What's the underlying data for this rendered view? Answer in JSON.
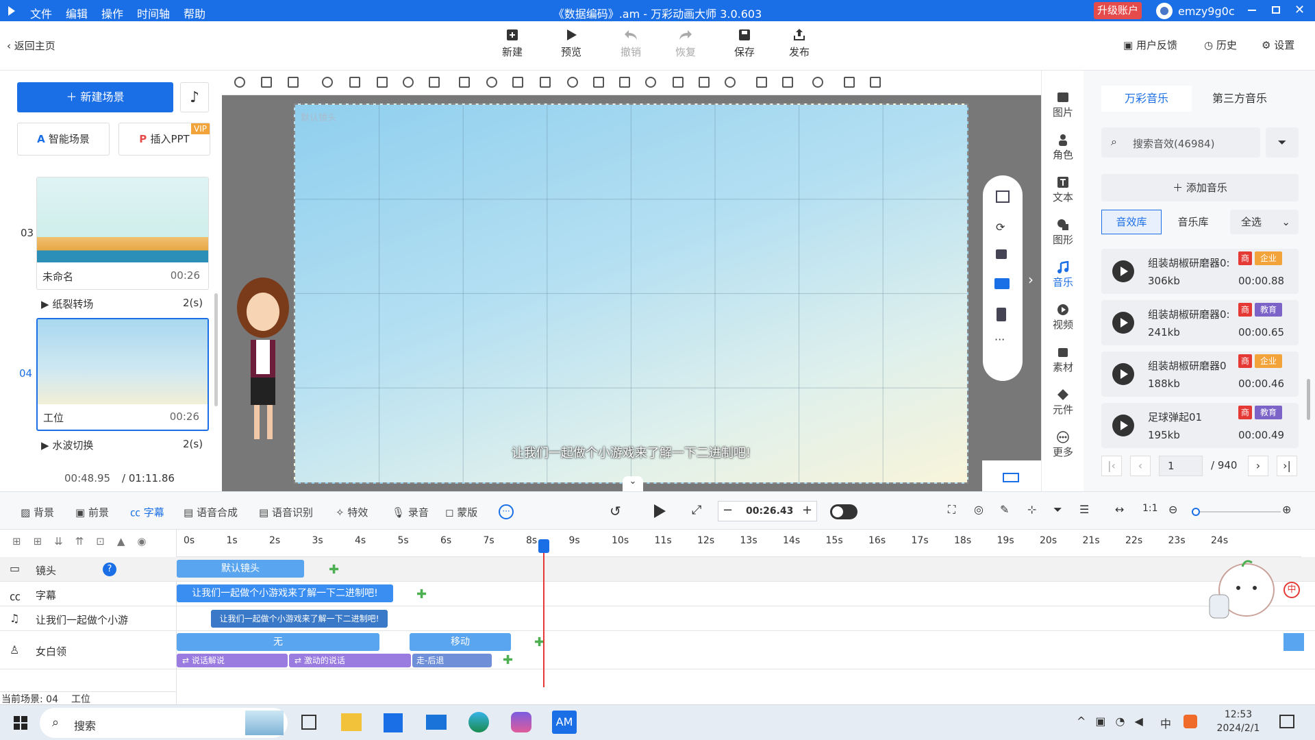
{
  "app": {
    "title": "《数据编码》.am - 万彩动画大师 3.0.603",
    "upgrade": "升级账户",
    "user": "emzy9g0c"
  },
  "menu": [
    "文件",
    "编辑",
    "操作",
    "时间轴",
    "帮助"
  ],
  "toolbar": {
    "back": "返回主页",
    "new": "新建",
    "preview": "预览",
    "undo": "撤销",
    "redo": "恢复",
    "save": "保存",
    "publish": "发布",
    "feedback": "用户反馈",
    "history": "历史",
    "settings": "设置"
  },
  "left": {
    "new_scene": "新建场景",
    "smart_scene": "智能场景",
    "insert_ppt": "插入PPT",
    "vip": "VIP",
    "scenes": [
      {
        "num": "03",
        "name": "未命名",
        "dur": "00:26"
      },
      {
        "num": "04",
        "name": "工位",
        "dur": "00:26"
      }
    ],
    "transitions": [
      {
        "name": "纸裂转场",
        "dur": "2(s)"
      },
      {
        "name": "水波切换",
        "dur": "2(s)"
      }
    ],
    "time_current": "00:48.95",
    "time_total": "/ 01:11.86"
  },
  "stage": {
    "camera_label": "默认镜头",
    "subtitle": "让我们一起做个小游戏来了解一下二进制吧!"
  },
  "sidebar": [
    "图片",
    "角色",
    "文本",
    "图形",
    "音乐",
    "视频",
    "素材",
    "元件",
    "更多"
  ],
  "music": {
    "tabs": [
      "万彩音乐",
      "第三方音乐"
    ],
    "search_placeholder": "搜索音效(46984)",
    "add": "添加音乐",
    "subtabs": [
      "音效库",
      "音乐库"
    ],
    "filter": "全选",
    "items": [
      {
        "name": "组装胡椒研磨器0:",
        "size": "306kb",
        "dur": "00:00.88",
        "tag1": "商",
        "tag2": "企业"
      },
      {
        "name": "组装胡椒研磨器0:",
        "size": "241kb",
        "dur": "00:00.65",
        "tag1": "商",
        "tag2": "教育"
      },
      {
        "name": "组装胡椒研磨器0",
        "size": "188kb",
        "dur": "00:00.46",
        "tag1": "商",
        "tag2": "企业"
      },
      {
        "name": "足球弹起01",
        "size": "195kb",
        "dur": "00:00.49",
        "tag1": "商",
        "tag2": "教育"
      }
    ],
    "page": "1",
    "pages": "/ 940"
  },
  "timeline": {
    "tools": [
      "背景",
      "前景",
      "字幕",
      "语音合成",
      "语音识别",
      "特效",
      "录音",
      "蒙版"
    ],
    "time": "00:26.43",
    "ruler": [
      "0s",
      "1s",
      "2s",
      "3s",
      "4s",
      "5s",
      "6s",
      "7s",
      "8s",
      "9s",
      "10s",
      "11s",
      "12s",
      "13s",
      "14s",
      "15s",
      "16s",
      "17s",
      "18s",
      "19s",
      "20s",
      "21s",
      "22s",
      "23s",
      "24s"
    ],
    "tracks": [
      "镜头",
      "字幕",
      "让我们一起做个小游",
      "女白领"
    ],
    "clips": {
      "camera": "默认镜头",
      "subtitle": "让我们一起做个小游戏来了解一下二进制吧!",
      "audio": "让我们一起做个小游戏来了解一下二进制吧!",
      "none": "无",
      "move": "移动",
      "act1": "说话解说",
      "act2": "激动的说话",
      "act3": "走-后退"
    },
    "status": "当前场景: 04",
    "status_name": "工位"
  },
  "taskbar": {
    "search": "搜索",
    "app": "AM",
    "time": "12:53",
    "date": "2024/2/1",
    "ime": "中"
  }
}
